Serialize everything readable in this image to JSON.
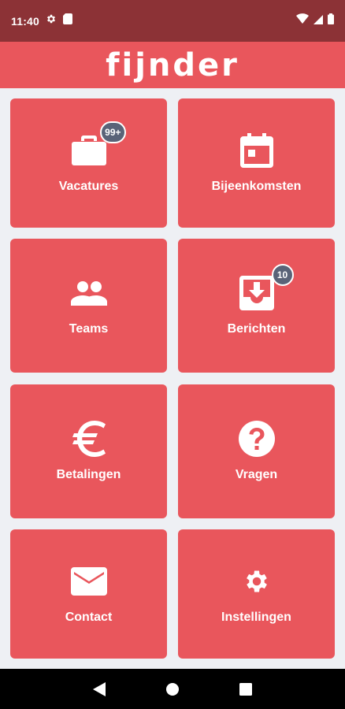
{
  "status_bar": {
    "time": "11:40",
    "icons": [
      "gear-icon",
      "sim-card-icon",
      "wifi-icon",
      "signal-icon",
      "battery-icon"
    ]
  },
  "app_bar": {
    "logo_text": "fijnder"
  },
  "tiles": [
    {
      "label": "Vacatures",
      "icon": "briefcase-icon",
      "badge": "99+"
    },
    {
      "label": "Bijeenkomsten",
      "icon": "calendar-icon",
      "badge": ""
    },
    {
      "label": "Teams",
      "icon": "people-icon",
      "badge": ""
    },
    {
      "label": "Berichten",
      "icon": "inbox-download-icon",
      "badge": "10"
    },
    {
      "label": "Betalingen",
      "icon": "euro-icon",
      "badge": ""
    },
    {
      "label": "Vragen",
      "icon": "help-icon",
      "badge": ""
    },
    {
      "label": "Contact",
      "icon": "mail-icon",
      "badge": ""
    },
    {
      "label": "Instellingen",
      "icon": "settings-icon",
      "badge": ""
    }
  ],
  "nav_bar": {
    "buttons": [
      "back-icon",
      "home-icon",
      "recents-icon"
    ]
  },
  "colors": {
    "primary": "#e9565c",
    "status_bar": "#8c3236",
    "background": "#eef0f4",
    "badge": "#5a6378"
  }
}
